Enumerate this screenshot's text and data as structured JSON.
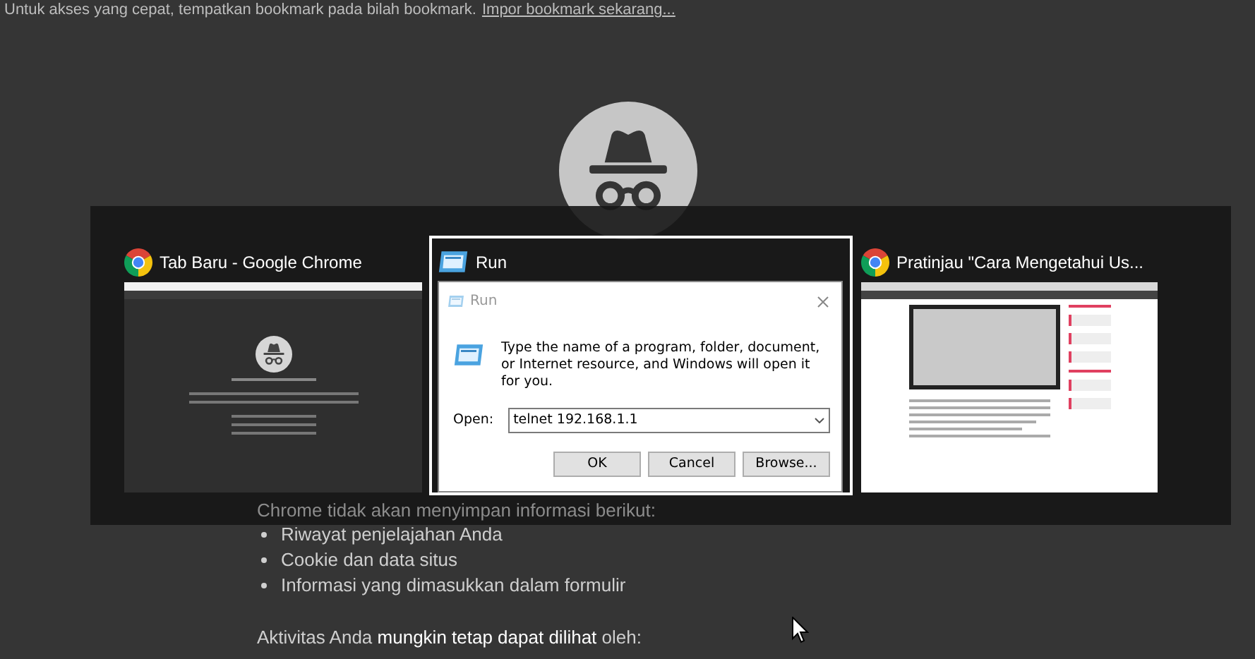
{
  "bookmark_bar": {
    "message": "Untuk akses yang cepat, tempatkan bookmark pada bilah bookmark.",
    "link": "Impor bookmark sekarang..."
  },
  "page": {
    "not_saved_heading": "Chrome tidak akan menyimpan informasi berikut:",
    "not_saved_items": [
      "Riwayat penjelajahan Anda",
      "Cookie dan data situs",
      "Informasi yang dimasukkan dalam formulir"
    ],
    "visible_to": "Aktivitas Anda **mungkin tetap dapat dilihat** oleh:"
  },
  "task_switcher": {
    "windows": [
      {
        "kind": "incognito",
        "title": "Tab Baru - Google Chrome",
        "selected": false
      },
      {
        "kind": "dialog",
        "title": "Run",
        "selected": true,
        "dialog": {
          "title": "Run",
          "message": "Type the name of a program, folder, document, or Internet resource, and Windows will open it for you.",
          "open_label": "Open:",
          "value": "telnet 192.168.1.1",
          "buttons": [
            "OK",
            "Cancel",
            "Browse..."
          ]
        }
      },
      {
        "kind": "article",
        "title": "Pratinjau \"Cara Mengetahui Us...",
        "selected": false
      }
    ]
  }
}
